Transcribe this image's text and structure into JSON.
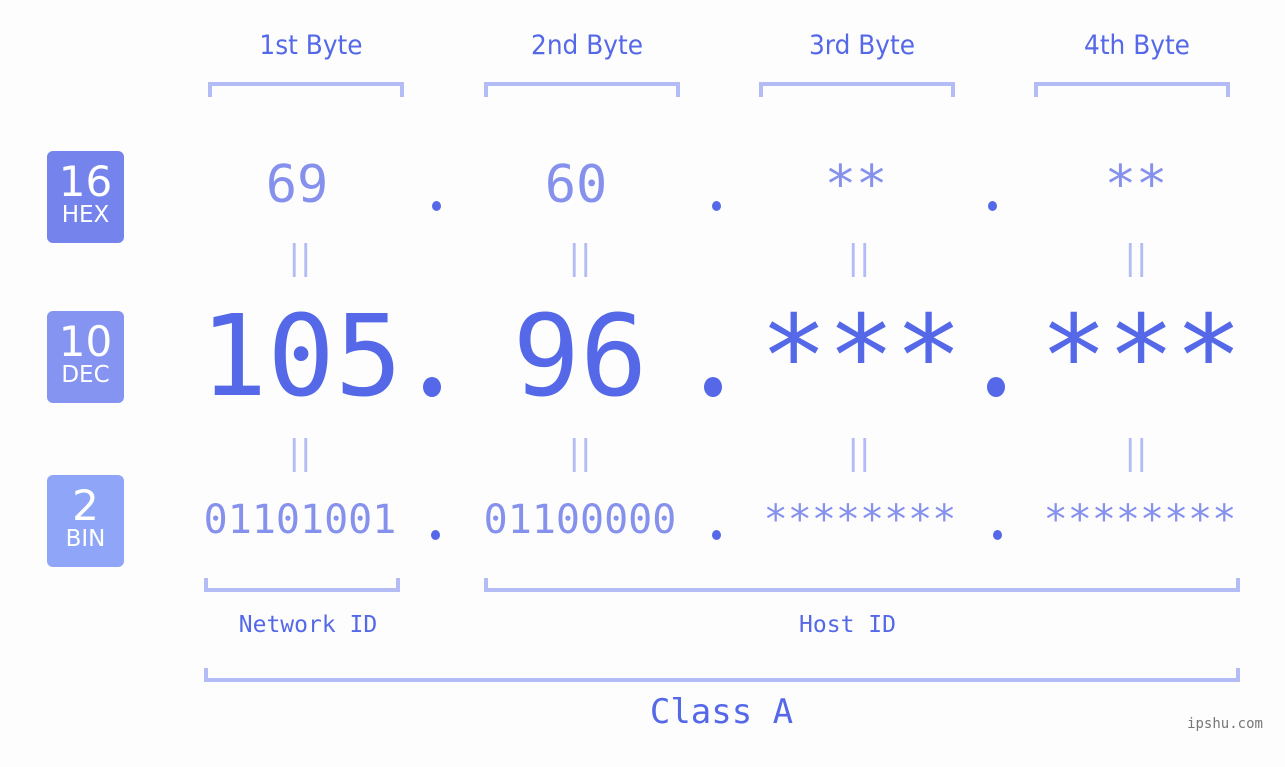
{
  "bytes": [
    {
      "label": "1st Byte",
      "hex": "69",
      "dec": "105",
      "bin": "01101001"
    },
    {
      "label": "2nd Byte",
      "hex": "60",
      "dec": "96",
      "bin": "01100000"
    },
    {
      "label": "3rd Byte",
      "hex": "**",
      "dec": "***",
      "bin": "********"
    },
    {
      "label": "4th Byte",
      "hex": "**",
      "dec": "***",
      "bin": "********"
    }
  ],
  "badges": {
    "hex": {
      "num": "16",
      "label": "HEX",
      "color": "#7584ec"
    },
    "dec": {
      "num": "10",
      "label": "DEC",
      "color": "#8494f0"
    },
    "bin": {
      "num": "2",
      "label": "BIN",
      "color": "#8fa6f8"
    }
  },
  "equals_sign": "||",
  "network_id_label": "Network ID",
  "host_id_label": "Host ID",
  "class_label": "Class A",
  "watermark": "ipshu.com",
  "colors": {
    "primary": "#5468e8",
    "secondary": "#8591ec",
    "bracket": "#b4bcf6",
    "background": "#fcfdfc"
  }
}
